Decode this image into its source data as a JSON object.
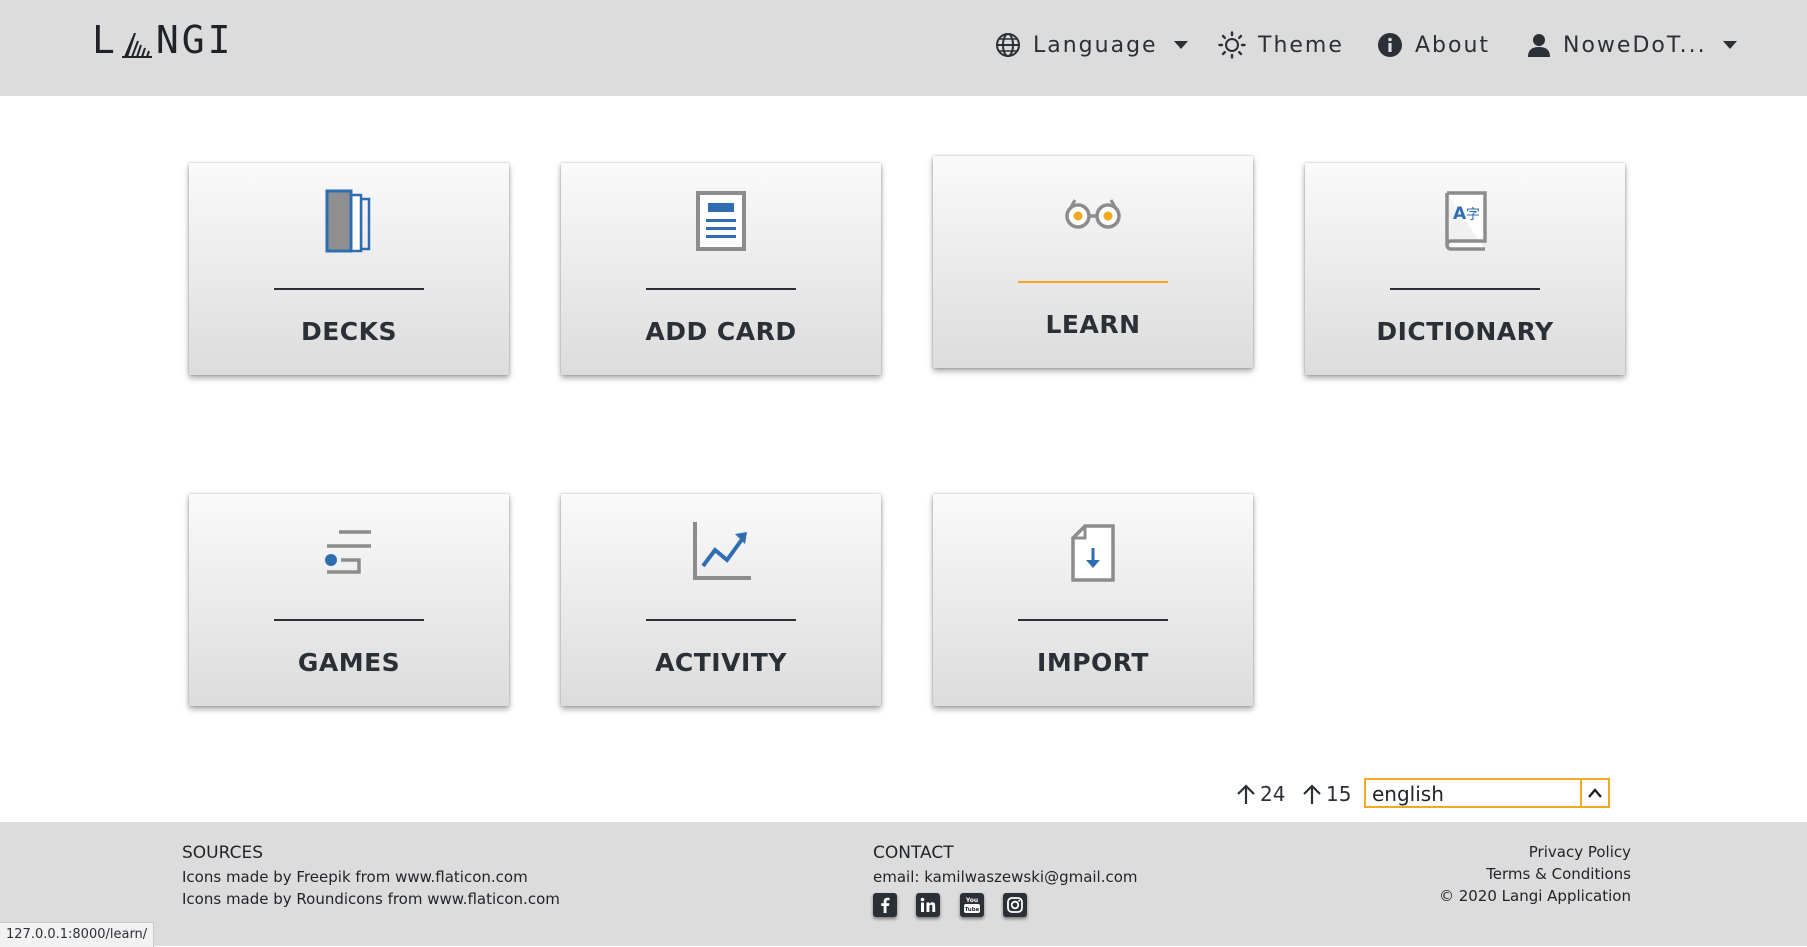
{
  "header": {
    "logo": "LANGI",
    "nav": {
      "language": "Language",
      "theme": "Theme",
      "about": "About",
      "user": "NoweDoT..."
    }
  },
  "tiles": [
    {
      "label": "DECKS",
      "icon": "cards-icon"
    },
    {
      "label": "ADD CARD",
      "icon": "add-card-icon"
    },
    {
      "label": "LEARN",
      "icon": "glasses-icon",
      "active": true
    },
    {
      "label": "DICTIONARY",
      "icon": "dictionary-book-icon"
    },
    {
      "label": "GAMES",
      "icon": "games-icon"
    },
    {
      "label": "ACTIVITY",
      "icon": "chart-trend-icon"
    },
    {
      "label": "IMPORT",
      "icon": "import-file-icon"
    }
  ],
  "stats": {
    "counter_1": "24",
    "counter_2": "15"
  },
  "language_select": {
    "value": "english"
  },
  "footer": {
    "sources_title": "SOURCES",
    "sources_lines": [
      "Icons made by Freepik from www.flaticon.com",
      "Icons made by Roundicons from www.flaticon.com"
    ],
    "contact_title": "CONTACT",
    "contact_email": "email: kamilwaszewski@gmail.com",
    "links": [
      "Privacy Policy",
      "Terms & Conditions",
      "© 2020 Langi Application"
    ],
    "social": [
      "facebook-icon",
      "linkedin-icon",
      "youtube-icon",
      "instagram-icon"
    ]
  },
  "status_url": "127.0.0.1:8000/learn/",
  "colors": {
    "accent": "#f4a81d",
    "icon_blue": "#2f6db3",
    "icon_gray": "#8c8c8c",
    "header_bg": "#dcdcdc"
  }
}
